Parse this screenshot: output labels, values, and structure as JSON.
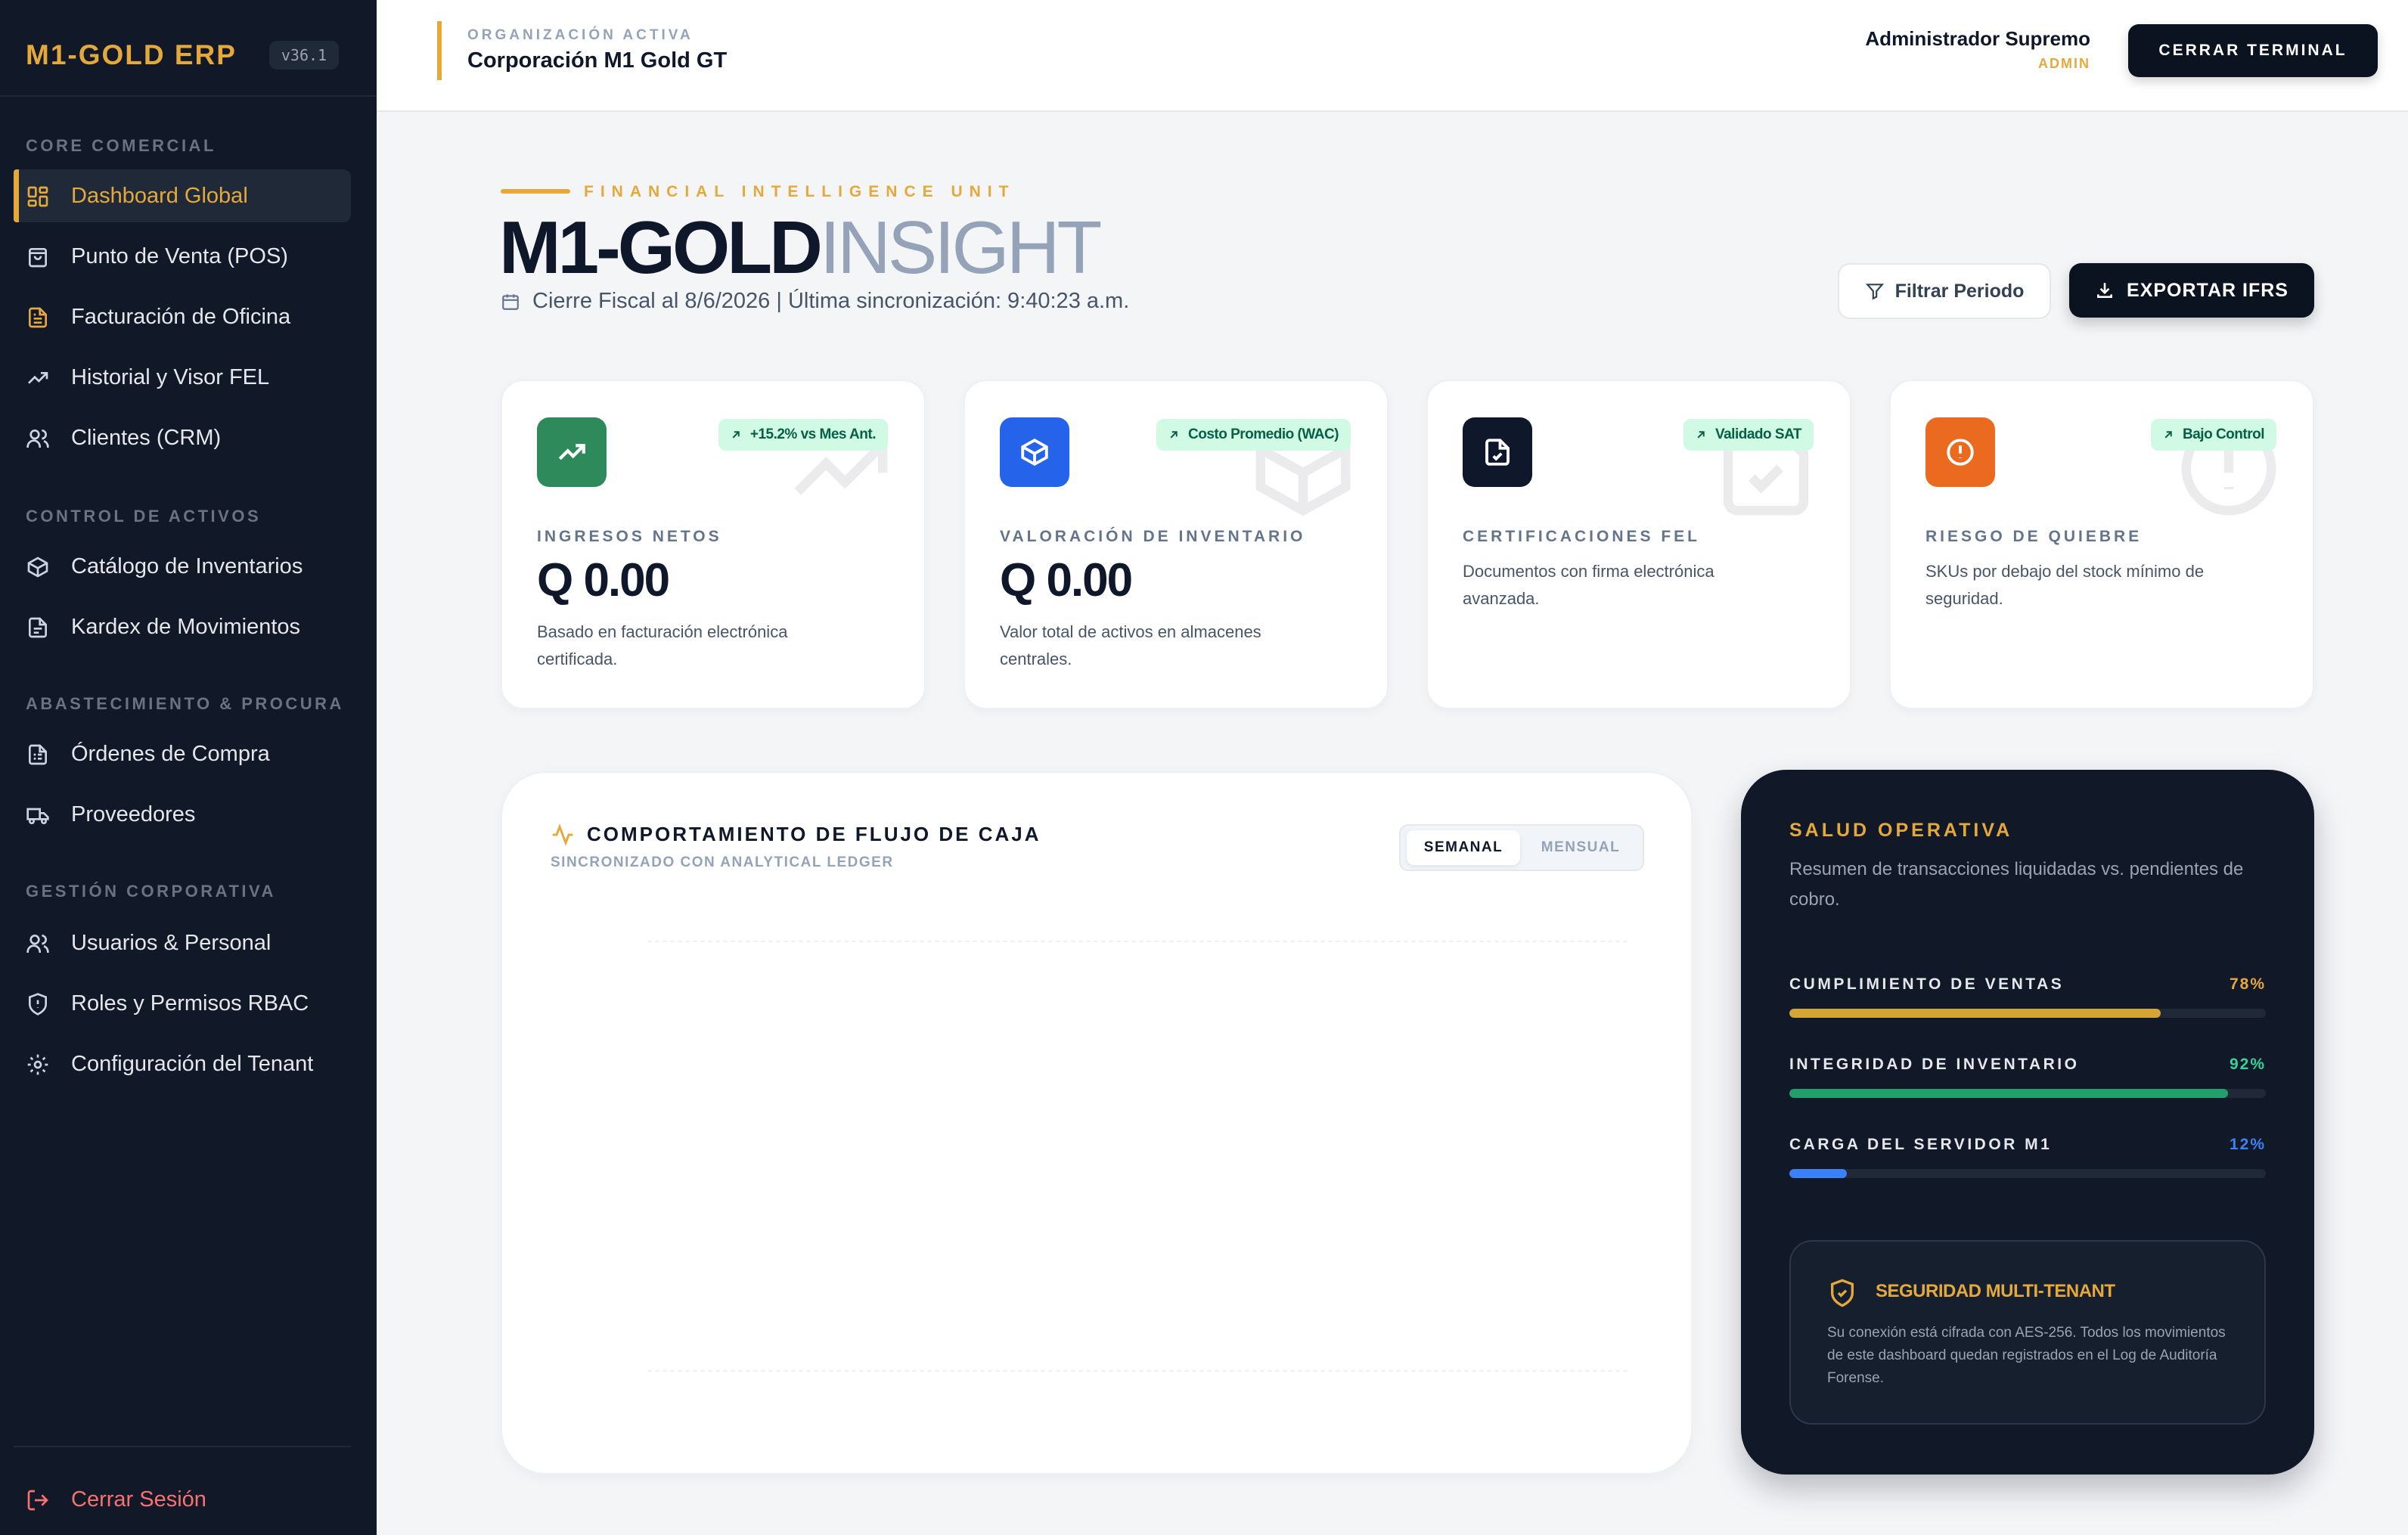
{
  "app": {
    "brand": "M1-GOLD ERP",
    "version": "v36.1"
  },
  "sidebar": {
    "sections": [
      {
        "title": "CORE COMERCIAL"
      },
      {
        "title": "CONTROL DE ACTIVOS"
      },
      {
        "title": "ABASTECIMIENTO & PROCURA"
      },
      {
        "title": "GESTIÓN CORPORATIVA"
      }
    ],
    "items": [
      {
        "label": "Dashboard Global",
        "icon": "grid-icon",
        "active": true
      },
      {
        "label": "Punto de Venta (POS)",
        "icon": "shopping-bag-icon"
      },
      {
        "label": "Facturación de Oficina",
        "icon": "invoice-icon"
      },
      {
        "label": "Historial y Visor FEL",
        "icon": "trending-up-icon"
      },
      {
        "label": "Clientes (CRM)",
        "icon": "users-icon"
      },
      {
        "label": "Catálogo de Inventarios",
        "icon": "box-icon"
      },
      {
        "label": "Kardex de Movimientos",
        "icon": "ledger-icon"
      },
      {
        "label": "Órdenes de Compra",
        "icon": "purchase-order-icon"
      },
      {
        "label": "Proveedores",
        "icon": "truck-icon"
      },
      {
        "label": "Usuarios & Personal",
        "icon": "users-icon"
      },
      {
        "label": "Roles y Permisos RBAC",
        "icon": "shield-icon"
      },
      {
        "label": "Configuración del Tenant",
        "icon": "gear-icon"
      }
    ],
    "logout": "Cerrar Sesión"
  },
  "header": {
    "org_kicker": "ORGANIZACIÓN ACTIVA",
    "org_name": "Corporación M1 Gold GT",
    "user_name": "Administrador Supremo",
    "user_role": "ADMIN",
    "terminal_button": "CERRAR TERMINAL"
  },
  "hero": {
    "kicker": "FINANCIAL INTELLIGENCE UNIT",
    "title_bold": "M1-GOLD",
    "title_light": "INSIGHT",
    "subtitle": "Cierre Fiscal al 8/6/2026 | Última sincronización: 9:40:23 a.m.",
    "filter_button": "Filtrar Periodo",
    "export_button": "EXPORTAR IFRS"
  },
  "cards": [
    {
      "label": "INGRESOS NETOS",
      "value": "Q 0.00",
      "desc": "Basado en facturación electrónica certificada.",
      "badge": "+15.2% vs Mes Ant.",
      "icon": "trending-up-icon",
      "color": "#2f8a5b"
    },
    {
      "label": "VALORACIÓN DE INVENTARIO",
      "value": "Q 0.00",
      "desc": "Valor total de activos en almacenes centrales.",
      "badge": "Costo Promedio (WAC)",
      "icon": "box-icon",
      "color": "#2563eb"
    },
    {
      "label": "CERTIFICACIONES FEL",
      "value": "",
      "desc": "Documentos con firma electrónica avanzada.",
      "badge": "Validado SAT",
      "icon": "file-check-icon",
      "color": "#0f172a"
    },
    {
      "label": "RIESGO DE QUIEBRE",
      "value": "",
      "desc": "SKUs por debajo del stock mínimo de seguridad.",
      "badge": "Bajo Control",
      "icon": "alert-circle-icon",
      "color": "#ea6a1f"
    }
  ],
  "cashflow": {
    "title": "COMPORTAMIENTO DE FLUJO DE CAJA",
    "subtitle": "SINCRONIZADO CON ANALYTICAL LEDGER",
    "tab_weekly": "SEMANAL",
    "tab_monthly": "MENSUAL"
  },
  "health": {
    "title": "SALUD OPERATIVA",
    "desc": "Resumen de transacciones liquidadas vs. pendientes de cobro.",
    "metrics": [
      {
        "label": "CUMPLIMIENTO DE VENTAS",
        "pct_text": "78%",
        "value": 0.78,
        "color": "#d4a534"
      },
      {
        "label": "INTEGRIDAD DE INVENTARIO",
        "pct_text": "92%",
        "value": 0.92,
        "color": "#22a06b"
      },
      {
        "label": "CARGA DEL SERVIDOR M1",
        "pct_text": "12%",
        "value": 0.12,
        "color": "#3b82f6"
      }
    ],
    "security_title": "SEGURIDAD MULTI-TENANT",
    "security_text": "Su conexión está cifrada con AES-256. Todos los movimientos de este dashboard quedan registrados en el Log de Auditoría Forense."
  }
}
